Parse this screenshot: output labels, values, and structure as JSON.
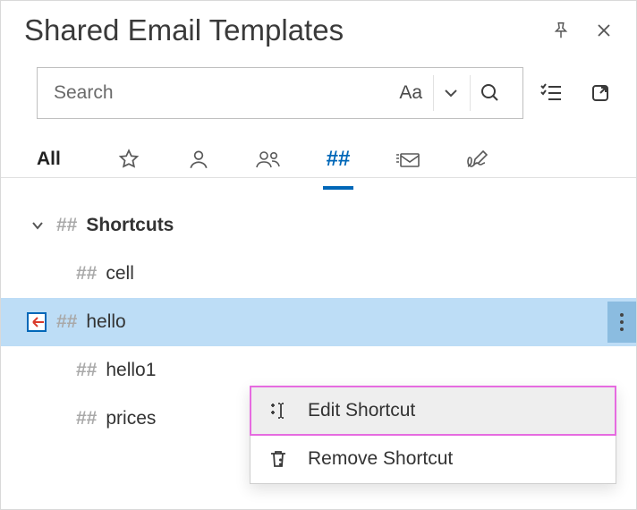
{
  "header": {
    "title": "Shared Email Templates"
  },
  "search": {
    "placeholder": "Search",
    "case_label": "Aa"
  },
  "tabs": {
    "all_label": "All",
    "active_index": 4
  },
  "tree": {
    "folder_label": "Shortcuts",
    "items": [
      {
        "label": "cell",
        "selected": false
      },
      {
        "label": "hello",
        "selected": true
      },
      {
        "label": "hello1",
        "selected": false
      },
      {
        "label": "prices",
        "selected": false
      }
    ]
  },
  "menu": {
    "edit_label": "Edit Shortcut",
    "remove_label": "Remove Shortcut"
  },
  "glyphs": {
    "hash": "##"
  }
}
